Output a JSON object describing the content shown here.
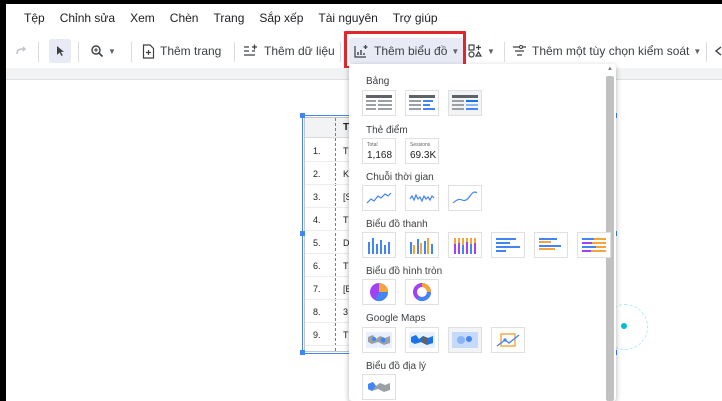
{
  "menu": {
    "items": [
      "Tệp",
      "Chỉnh sửa",
      "Xem",
      "Chèn",
      "Trang",
      "Sắp xếp",
      "Tài nguyên",
      "Trợ giúp"
    ]
  },
  "toolbar": {
    "add_page_label": "Thêm trang",
    "add_data_label": "Thêm dữ liệu",
    "add_chart_label": "Thêm biểu đồ",
    "add_control_label": "Thêm một tùy chọn kiểm soát"
  },
  "table_preview": {
    "header": "T",
    "rows": [
      {
        "n": "1.",
        "v": "T"
      },
      {
        "n": "2.",
        "v": "K"
      },
      {
        "n": "3.",
        "v": "[S"
      },
      {
        "n": "4.",
        "v": "T"
      },
      {
        "n": "5.",
        "v": "D"
      },
      {
        "n": "6.",
        "v": "T"
      },
      {
        "n": "7.",
        "v": "[B"
      },
      {
        "n": "8.",
        "v": "3"
      },
      {
        "n": "9.",
        "v": "T"
      }
    ]
  },
  "chart_menu": {
    "sections": {
      "table": "Bảng",
      "scorecard": "Thẻ điểm",
      "timeseries": "Chuỗi thời gian",
      "bar": "Biểu đồ thanh",
      "pie": "Biểu đồ hình tròn",
      "maps": "Google Maps",
      "geo": "Biểu đồ địa lý"
    },
    "scorecards": [
      {
        "label": "Total",
        "value": "1,168"
      },
      {
        "label": "Sessions",
        "value": "69.3K"
      }
    ]
  },
  "colors": {
    "accent": "#4285f4",
    "highlight": "#e3262c",
    "orange": "#f4a53a",
    "purple": "#a142f4"
  }
}
